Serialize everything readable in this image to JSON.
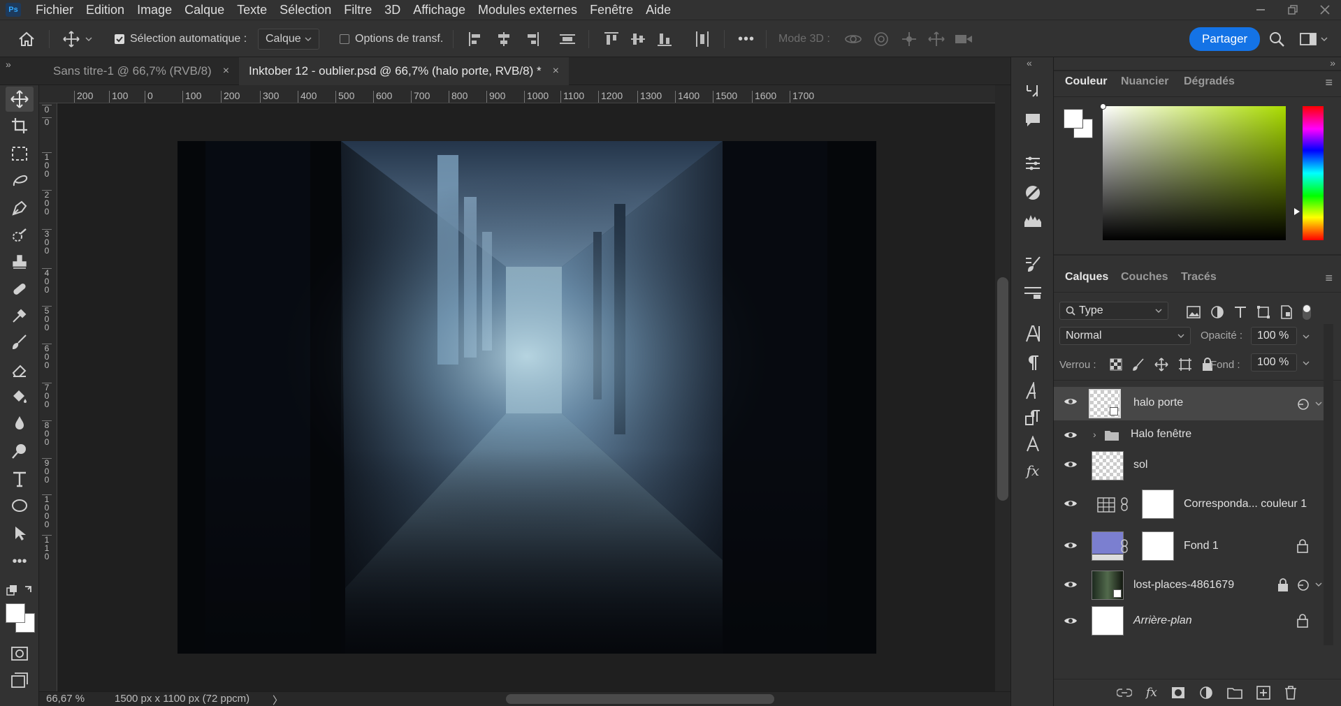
{
  "menubar": {
    "logo": "Ps",
    "items": [
      "Fichier",
      "Edition",
      "Image",
      "Calque",
      "Texte",
      "Sélection",
      "Filtre",
      "3D",
      "Affichage",
      "Modules externes",
      "Fenêtre",
      "Aide"
    ]
  },
  "options": {
    "auto_select_label": "Sélection automatique :",
    "auto_select_value": "Calque",
    "transform_label": "Options de transf.",
    "mode3d_label": "Mode 3D :",
    "share_label": "Partager",
    "more": "•••"
  },
  "tabs": [
    {
      "label": "Sans titre-1 @ 66,7% (RVB/8)",
      "close": "×"
    },
    {
      "label": "Inktober 12 - oublier.psd @ 66,7% (halo porte, RVB/8) *",
      "close": "×"
    }
  ],
  "ruler_h": [
    "200",
    "100",
    "0",
    "100",
    "200",
    "300",
    "400",
    "500",
    "600",
    "700",
    "800",
    "900",
    "1000",
    "1100",
    "1200",
    "1300",
    "1400",
    "1500",
    "1600",
    "1700"
  ],
  "ruler_v": [
    "0",
    "0",
    "1 0 0",
    "2 0 0",
    "3 0 0",
    "4 0 0",
    "5 0 0",
    "6 0 0",
    "7 0 0",
    "8 0 0",
    "9 0 0",
    "1 0 0 0",
    "1 1 0"
  ],
  "status": {
    "zoom": "66,67 %",
    "doc_size": "1500 px x 1100 px (72 ppcm)",
    "arrow": "〉"
  },
  "color_panel": {
    "tabs": [
      "Couleur",
      "Nuancier",
      "Dégradés"
    ],
    "foreground": "#ffffff",
    "background": "#ffffff",
    "hue_color": "#aadc00"
  },
  "layers_panel": {
    "tabs": [
      "Calques",
      "Couches",
      "Tracés"
    ],
    "filter_label": "Type",
    "blend_mode": "Normal",
    "opacity_label": "Opacité :",
    "opacity_value": "100 %",
    "lock_label": "Verrou :",
    "fill_label": "Fond :",
    "fill_value": "100 %",
    "layers": [
      {
        "name": "halo porte",
        "selected": true
      },
      {
        "name": "Halo fenêtre",
        "group": true
      },
      {
        "name": "sol"
      },
      {
        "name": "Corresponda... couleur 1"
      },
      {
        "name": "Fond 1",
        "color": "#7b7fd0"
      },
      {
        "name": "lost-places-4861679"
      },
      {
        "name": "Arrière-plan"
      }
    ]
  },
  "colors": {
    "accent": "#1473e6",
    "panel": "#323232",
    "canvas_bg": "#1f1f1f"
  }
}
